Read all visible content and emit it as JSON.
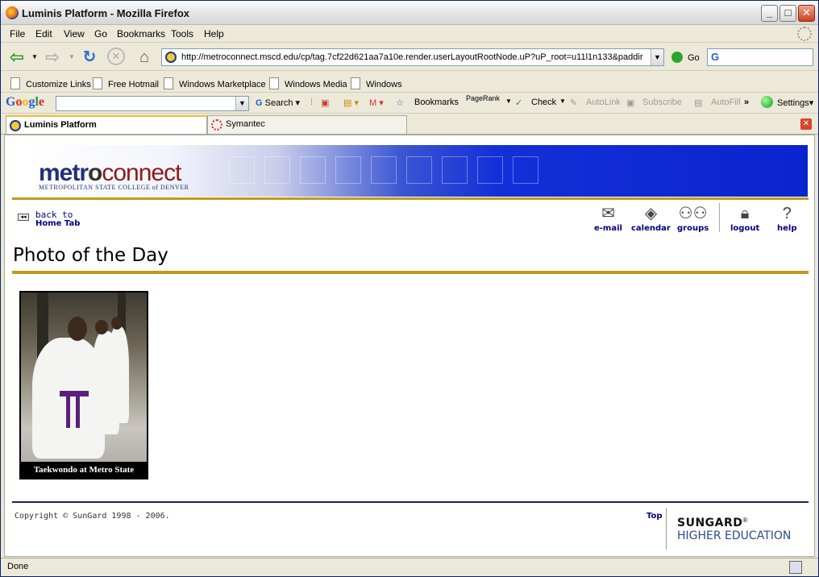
{
  "window": {
    "title": "Luminis Platform - Mozilla Firefox"
  },
  "menu": [
    "File",
    "Edit",
    "View",
    "Go",
    "Bookmarks",
    "Tools",
    "Help"
  ],
  "nav": {
    "url": "http://metroconnect.mscd.edu/cp/tag.7cf22d621aa7a10e.render.userLayoutRootNode.uP?uP_root=u11l1n133&paddir",
    "go_label": "Go",
    "search_engine": "G"
  },
  "bookmarks": [
    "Customize Links",
    "Free Hotmail",
    "Windows Marketplace",
    "Windows Media",
    "Windows"
  ],
  "google_toolbar": {
    "logo": "Google",
    "search_label": "Search",
    "bookmarks_label": "Bookmarks",
    "pagerank_label": "PageRank",
    "check_label": "Check",
    "autolink_label": "AutoLink",
    "subscribe_label": "Subscribe",
    "autofill_label": "AutoFill",
    "more_label": "»",
    "settings_label": "Settings"
  },
  "tabs": [
    {
      "label": "Luminis Platform",
      "active": true
    },
    {
      "label": "Symantec",
      "active": false
    }
  ],
  "page": {
    "logo_part1": "metr",
    "logo_o": "o",
    "logo_part2": "connect",
    "logo_sub": "METROPOLITAN STATE COLLEGE of DENVER",
    "back_line1": "back to",
    "back_line2": "Home Tab",
    "quick_links": [
      {
        "label": "e-mail",
        "icon": "envelope-icon"
      },
      {
        "label": "calendar",
        "icon": "calendar-icon"
      },
      {
        "label": "groups",
        "icon": "groups-icon"
      },
      {
        "label": "logout",
        "icon": "lock-icon"
      },
      {
        "label": "help",
        "icon": "question-icon"
      }
    ],
    "title": "Photo of the Day",
    "photo_caption": "Taekwondo at Metro State",
    "copyright": "Copyright © SunGard 1998 - 2006.",
    "top_link": "Top",
    "sungard_line1": "SUNGARD",
    "sungard_reg": "®",
    "sungard_line2": "HIGHER EDUCATION"
  },
  "status": {
    "text": "Done"
  },
  "colors": {
    "gold_rule": "#c29a1c",
    "navy_link": "#000080",
    "banner_blue": "#1330d8",
    "logo_red": "#8a1a1a"
  }
}
